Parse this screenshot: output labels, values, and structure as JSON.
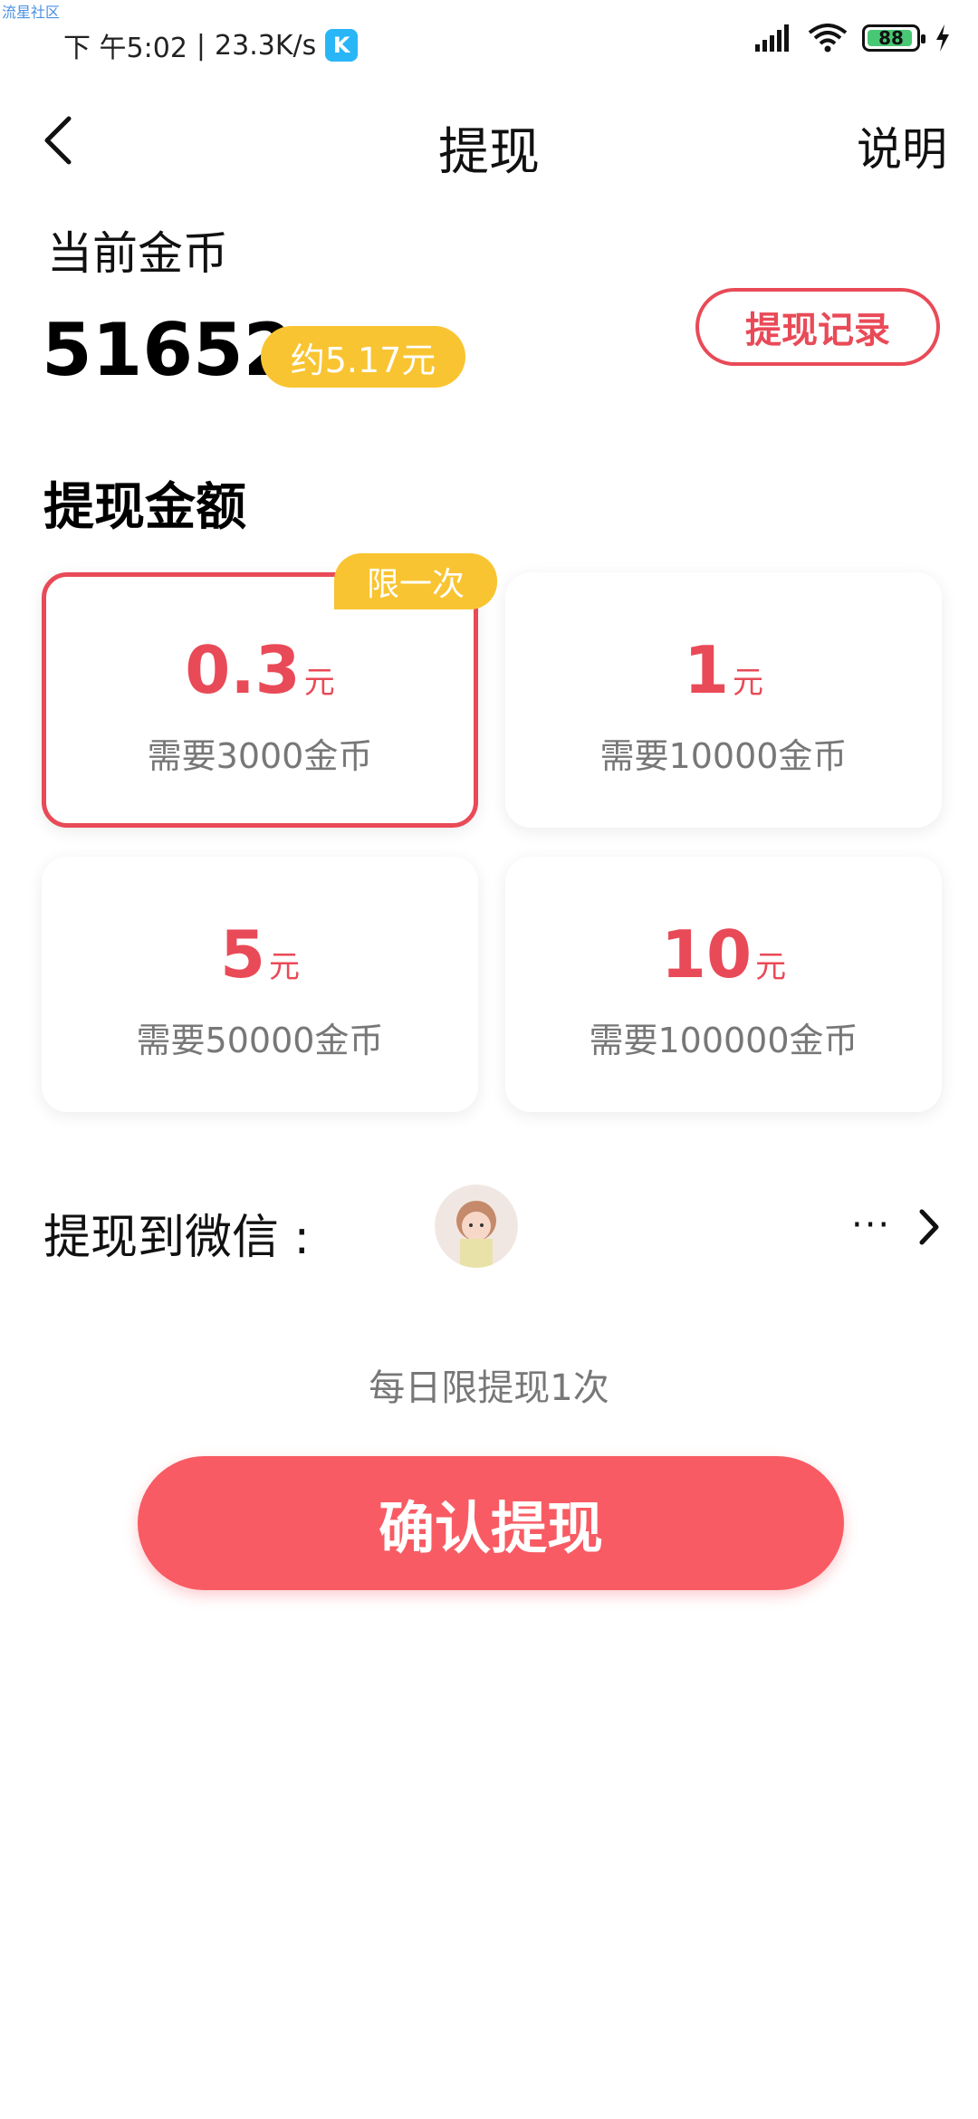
{
  "watermark": "流星社区",
  "status_bar": {
    "time": "下 午5:02",
    "separator": "|",
    "speed": "23.3K/s",
    "app_badge": "K",
    "battery": "88",
    "icons": [
      "signal-icon",
      "wifi-icon",
      "battery-icon",
      "charging-icon"
    ]
  },
  "header": {
    "title": "提现",
    "help": "说明",
    "back_icon": "chevron-left-icon"
  },
  "balance": {
    "label": "当前金币",
    "value": "51652",
    "approx": "约5.17元",
    "history_button": "提现记录"
  },
  "section_title": "提现金额",
  "options": [
    {
      "amount": "0.3",
      "unit": "元",
      "cost": "需要3000金币",
      "tag": "限一次",
      "selected": true
    },
    {
      "amount": "1",
      "unit": "元",
      "cost": "需要10000金币",
      "tag": "",
      "selected": false
    },
    {
      "amount": "5",
      "unit": "元",
      "cost": "需要50000金币",
      "tag": "",
      "selected": false
    },
    {
      "amount": "10",
      "unit": "元",
      "cost": "需要100000金币",
      "tag": "",
      "selected": false
    }
  ],
  "withdraw_to": {
    "label": "提现到微信 :",
    "more": "···",
    "arrow_icon": "chevron-right-icon"
  },
  "daily_limit": "每日限提现1次",
  "confirm_button": "确认提现",
  "colors": {
    "accent_red": "#e94a57",
    "button_red": "#f85b63",
    "tag_yellow": "#f9c431"
  }
}
